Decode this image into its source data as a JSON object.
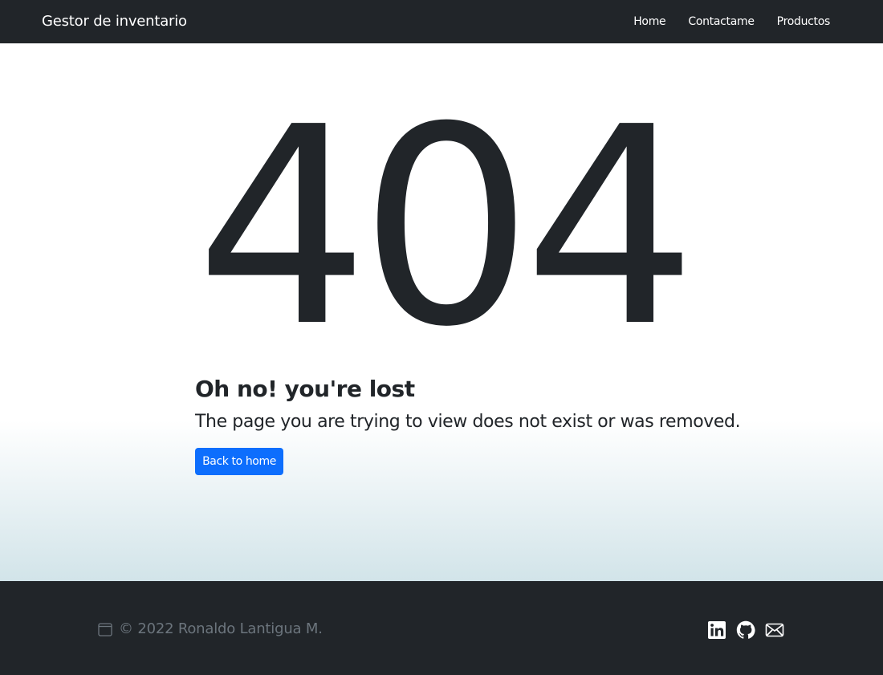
{
  "navbar": {
    "brand": "Gestor de inventario",
    "links": [
      {
        "label": "Home"
      },
      {
        "label": "Contactame"
      },
      {
        "label": "Productos"
      }
    ]
  },
  "error": {
    "code": "404",
    "title": "Oh no! you're lost",
    "description": "The page you are trying to view does not exist or was removed.",
    "button_label": "Back to home"
  },
  "footer": {
    "copyright": "© 2022 Ronaldo Lantigua M.",
    "icons": [
      "calendar-icon",
      "linkedin-icon",
      "github-icon",
      "envelope-icon"
    ]
  },
  "colors": {
    "navbar_bg": "#212529",
    "primary": "#0d6efd",
    "footer_text": "#6c757d",
    "gradient_end": "#d2e4e9"
  }
}
